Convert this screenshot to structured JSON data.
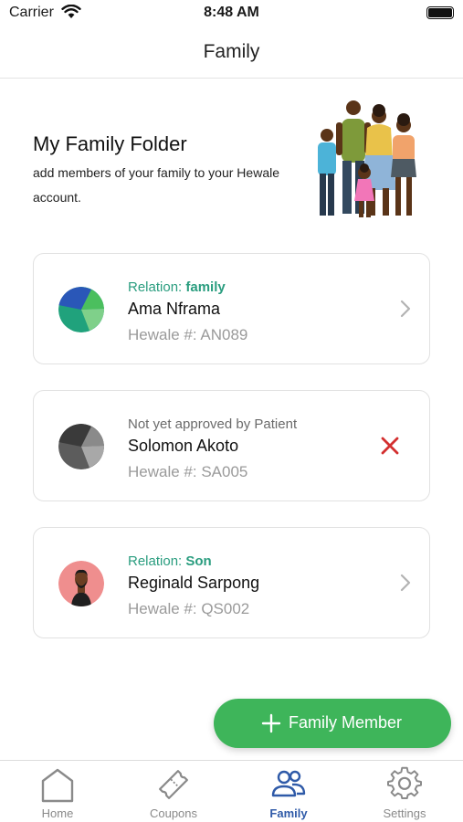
{
  "status_bar": {
    "carrier": "Carrier",
    "time": "8:48 AM"
  },
  "nav": {
    "title": "Family"
  },
  "header": {
    "title": "My Family Folder",
    "description": "add members of your family to your Hewale account."
  },
  "members": [
    {
      "relation_prefix": "Relation: ",
      "relation": "family",
      "name": "Ama Nframa",
      "hewale": "Hewale #: AN089",
      "action": "chevron-right-icon"
    },
    {
      "status": "Not yet approved by Patient",
      "name": "Solomon Akoto",
      "hewale": "Hewale #: SA005",
      "action": "close-icon"
    },
    {
      "relation_prefix": "Relation: ",
      "relation": "Son",
      "name": "Reginald Sarpong",
      "hewale": "Hewale #: QS002",
      "action": "chevron-right-icon"
    }
  ],
  "fab": {
    "label": "Family Member",
    "icon": "plus-icon"
  },
  "tabs": [
    {
      "label": "Home",
      "icon": "home-icon"
    },
    {
      "label": "Coupons",
      "icon": "ticket-icon"
    },
    {
      "label": "Family",
      "icon": "people-icon",
      "active": true
    },
    {
      "label": "Settings",
      "icon": "gear-icon"
    }
  ],
  "colors": {
    "accent_green": "#3eb55a",
    "relation_teal": "#2a9d7f",
    "active_tab_blue": "#2f5aa8",
    "reject_red": "#d32f2f"
  }
}
